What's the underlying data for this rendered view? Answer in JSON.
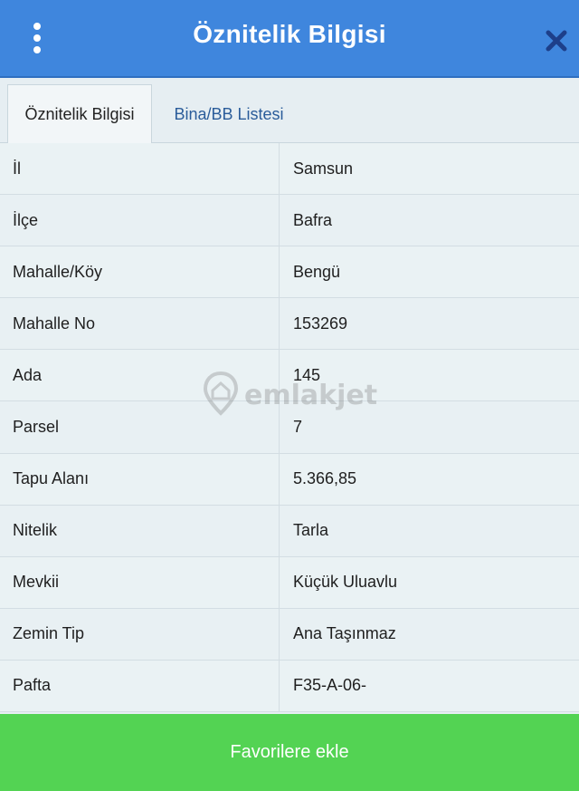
{
  "header": {
    "title": "Öznitelik Bilgisi",
    "menu_icon": "more-vertical-icon",
    "close_icon": "close-icon",
    "color": "#3f86dd"
  },
  "tabs": [
    {
      "label": "Öznitelik Bilgisi",
      "active": true
    },
    {
      "label": "Bina/BB Listesi",
      "active": false
    }
  ],
  "rows": [
    {
      "label": "İl",
      "value": "Samsun"
    },
    {
      "label": "İlçe",
      "value": "Bafra"
    },
    {
      "label": "Mahalle/Köy",
      "value": "Bengü"
    },
    {
      "label": "Mahalle No",
      "value": "153269"
    },
    {
      "label": "Ada",
      "value": "145"
    },
    {
      "label": "Parsel",
      "value": "7"
    },
    {
      "label": "Tapu Alanı",
      "value": "5.366,85"
    },
    {
      "label": "Nitelik",
      "value": "Tarla"
    },
    {
      "label": "Mevkii",
      "value": "Küçük Uluavlu"
    },
    {
      "label": "Zemin Tip",
      "value": "Ana Taşınmaz"
    },
    {
      "label": "Pafta",
      "value": "F35-A-06-"
    }
  ],
  "watermark": {
    "text": "emlakjet",
    "icon": "location-house-icon"
  },
  "footer": {
    "button_label": "Favorilere ekle",
    "color": "#53d353"
  }
}
